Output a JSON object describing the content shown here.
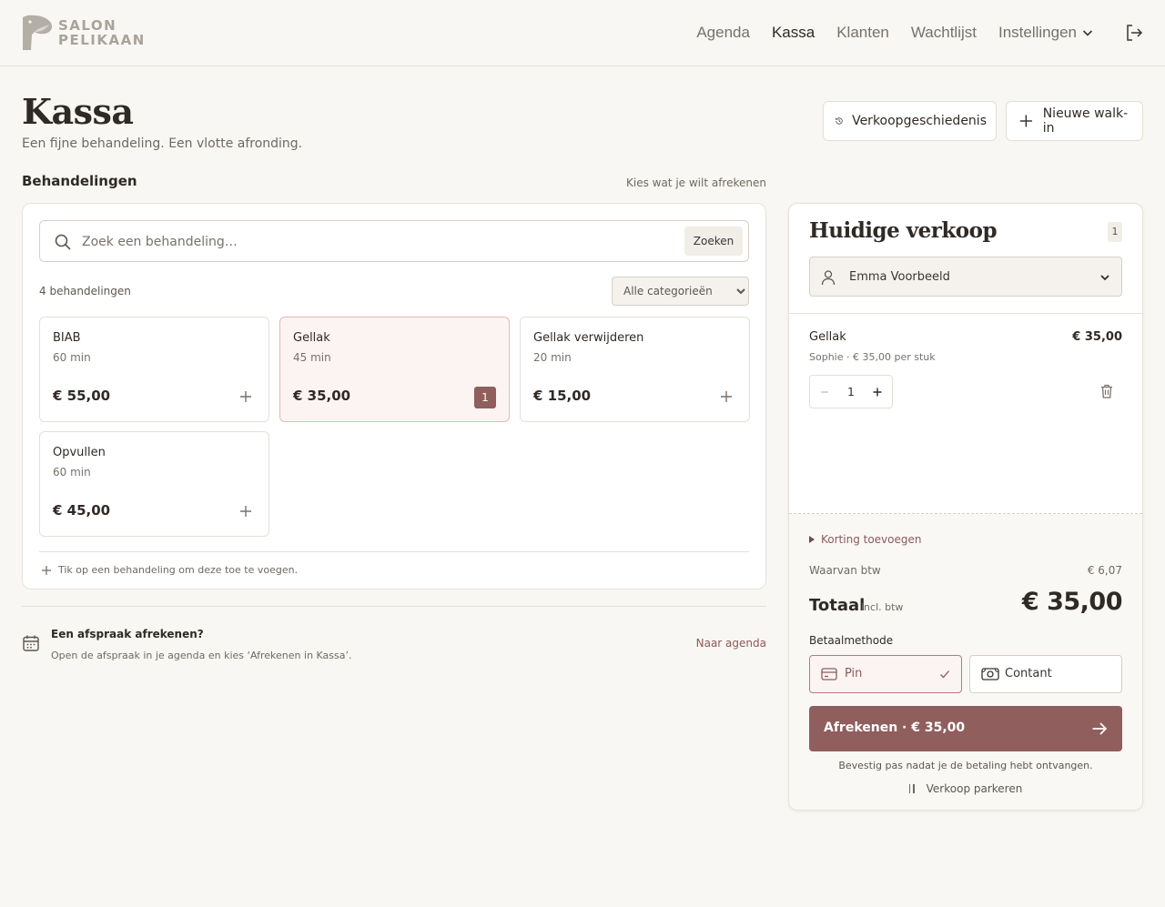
{
  "brand": {
    "line1": "SALON",
    "line2": "PELIKAAN",
    "logo_icon": "pelican-logo-icon"
  },
  "nav": {
    "items": [
      {
        "label": "Agenda",
        "active": false
      },
      {
        "label": "Kassa",
        "active": true
      },
      {
        "label": "Klanten",
        "active": false
      },
      {
        "label": "Wachtlijst",
        "active": false
      },
      {
        "label": "Instellingen",
        "active": false
      }
    ],
    "logout_icon": "logout-icon"
  },
  "page": {
    "title": "Kassa",
    "subtitle": "Een fijne behandeling. Een vlotte afronding.",
    "history_button": "Verkoopgeschiedenis",
    "walkin_button": "Nieuwe walk-in"
  },
  "treatments": {
    "title": "Behandelingen",
    "hint": "Kies wat je wilt afrekenen",
    "search_placeholder": "Zoek een behandeling…",
    "search_value": "",
    "search_button": "Zoeken",
    "count": "4 behandelingen",
    "category_selected": "Alle categorieën",
    "items": [
      {
        "name": "BIAB",
        "duration": "60 min",
        "price": "€ 55,00",
        "selected": false,
        "qty": ""
      },
      {
        "name": "Gellak",
        "duration": "45 min",
        "price": "€ 35,00",
        "selected": true,
        "qty": "1"
      },
      {
        "name": "Gellak verwijderen",
        "duration": "20 min",
        "price": "€ 15,00",
        "selected": false,
        "qty": ""
      },
      {
        "name": "Opvullen",
        "duration": "60 min",
        "price": "€ 45,00",
        "selected": false,
        "qty": ""
      }
    ],
    "tip": "Tik op een behandeling om deze toe te voegen."
  },
  "appointment": {
    "title": "Een afspraak afrekenen?",
    "subtitle": "Open de afspraak in je agenda en kies ‘Afrekenen in Kassa’.",
    "link": "Naar agenda"
  },
  "sale": {
    "title": "Huidige verkoop",
    "item_count": "1",
    "customer": "Emma Voorbeeld",
    "line": {
      "name": "Gellak",
      "price": "€ 35,00",
      "meta": "Sophie · € 35,00 per stuk",
      "qty": "1"
    },
    "discount": "Korting toevoegen",
    "vat_label": "Waarvan btw",
    "vat_value": "€ 6,07",
    "total_label": "Totaal",
    "total_note": "incl. btw",
    "total_value": "€ 35,00",
    "payment_label": "Betaalmethode",
    "payment_methods": [
      {
        "label": "Pin",
        "selected": true,
        "icon": "card-icon"
      },
      {
        "label": "Contant",
        "selected": false,
        "icon": "cash-icon"
      }
    ],
    "checkout_label": "Afrekenen · € 35,00",
    "confirm_note": "Bevestig pas nadat je de betaling hebt ontvangen.",
    "park_label": "Verkoop parkeren"
  },
  "colors": {
    "accent": "#8f5e5d",
    "background": "#f9f7f3",
    "selected_card": "#fcf4f2"
  }
}
